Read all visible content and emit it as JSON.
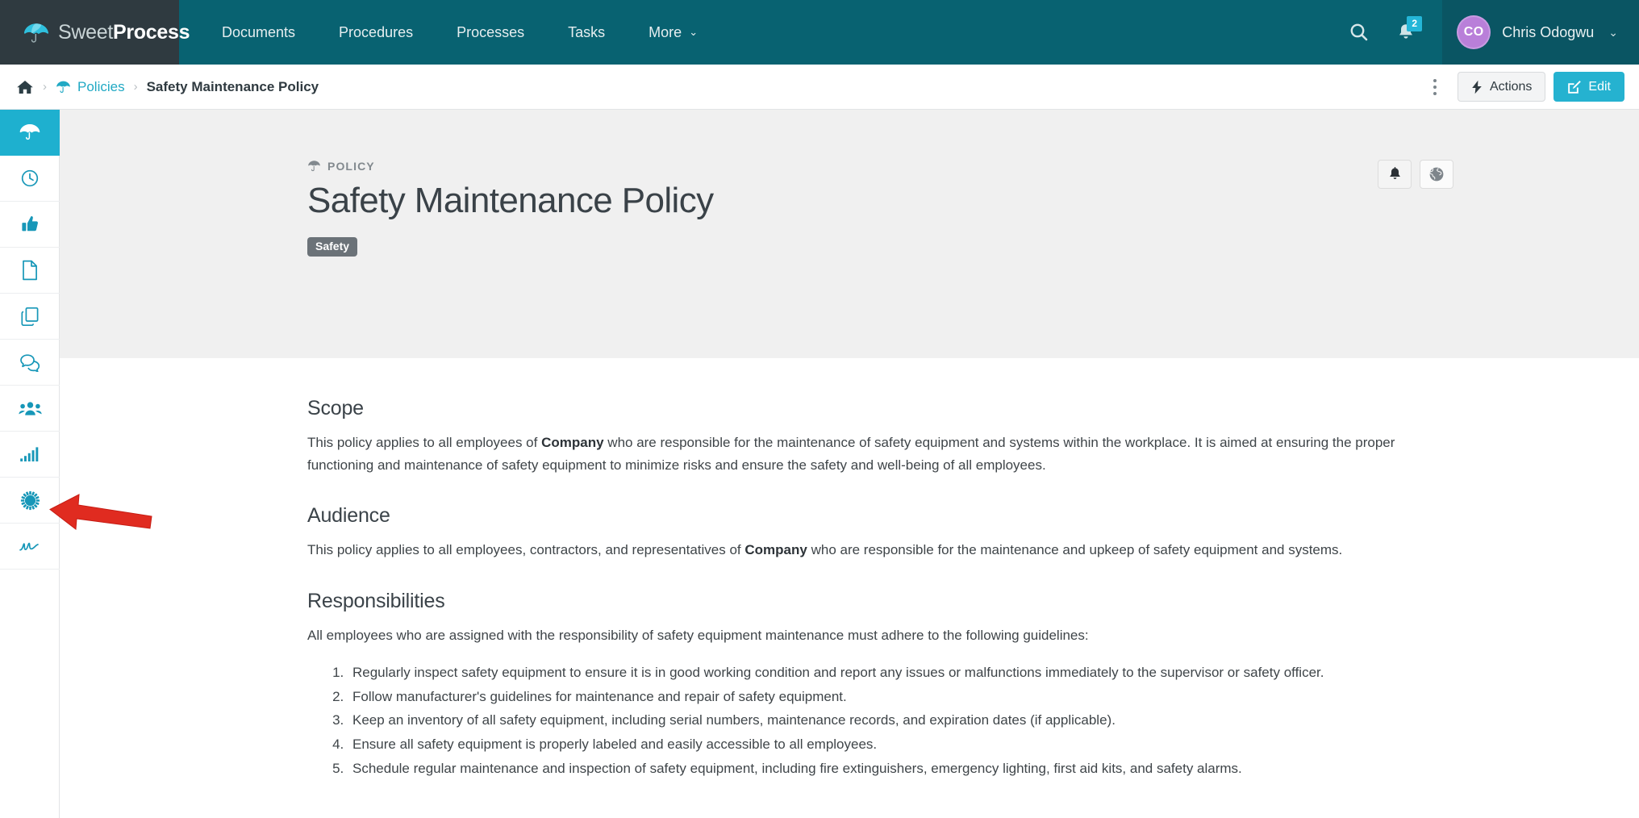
{
  "brand": {
    "name_light": "Sweet",
    "name_bold": "Process",
    "logo_icon": "umbrella-logo-icon"
  },
  "topnav": {
    "items": [
      {
        "label": "Documents",
        "name": "documents"
      },
      {
        "label": "Procedures",
        "name": "procedures"
      },
      {
        "label": "Processes",
        "name": "processes"
      },
      {
        "label": "Tasks",
        "name": "tasks"
      },
      {
        "label": "More",
        "name": "more",
        "has_caret": true
      }
    ],
    "more_caret": "⌄",
    "search_icon": "search-icon",
    "notifications_icon": "bell-icon",
    "notifications_count": "2",
    "user": {
      "initials": "CO",
      "name": "Chris Odogwu",
      "caret": "⌄"
    },
    "colors": {
      "nav_background": "#086271",
      "brand_background": "#2f3a40",
      "badge": "#24b6d8",
      "avatar": "#b97fd9"
    }
  },
  "breadcrumb": {
    "home_icon": "home-icon",
    "separator": "›",
    "policies_label": "Policies",
    "policies_icon": "umbrella-icon",
    "current_label": "Safety Maintenance Policy",
    "kebab_icon": "more-vertical-icon",
    "actions_label": "Actions",
    "actions_icon": "lightning-bolt-icon",
    "edit_label": "Edit",
    "edit_icon": "pencil-square-icon",
    "colors": {
      "link": "#21a9c4",
      "edit_button": "#25b2d0"
    }
  },
  "sidebar": {
    "items": [
      {
        "name": "policies",
        "icon": "umbrella-icon",
        "active": true
      },
      {
        "name": "recent",
        "icon": "clock-icon",
        "active": false
      },
      {
        "name": "approvals",
        "icon": "thumbs-up-icon",
        "active": false
      },
      {
        "name": "documents",
        "icon": "document-icon",
        "active": false
      },
      {
        "name": "duplicates",
        "icon": "copy-icon",
        "active": false
      },
      {
        "name": "comments",
        "icon": "chat-bubbles-icon",
        "active": false
      },
      {
        "name": "teams",
        "icon": "users-icon",
        "active": false
      },
      {
        "name": "reports",
        "icon": "bar-chart-icon",
        "active": false
      },
      {
        "name": "settings",
        "icon": "gear-sunburst-icon",
        "active": false
      },
      {
        "name": "signature",
        "icon": "signature-icon",
        "active": false
      }
    ],
    "colors": {
      "active_background": "#1eb0cf",
      "icon": "#1797b8"
    }
  },
  "document": {
    "kicker": "POLICY",
    "kicker_icon": "umbrella-icon",
    "title": "Safety Maintenance Policy",
    "tags": [
      "Safety"
    ],
    "hero_buttons": [
      {
        "name": "subscribe-button",
        "icon": "bell-icon"
      },
      {
        "name": "visibility-button",
        "icon": "globe-icon"
      }
    ],
    "sections": [
      {
        "heading": "Scope",
        "paragraph_before": "This policy applies to all employees of ",
        "paragraph_bold": "Company",
        "paragraph_after": " who are responsible for the maintenance of safety equipment and systems within the workplace. It is aimed at ensuring the proper functioning and maintenance of safety equipment to minimize risks and ensure the safety and well-being of all employees."
      },
      {
        "heading": "Audience",
        "paragraph_before": "This policy applies to all employees, contractors, and representatives of ",
        "paragraph_bold": "Company",
        "paragraph_after": " who are responsible for the maintenance and upkeep of safety equipment and systems."
      }
    ],
    "responsibilities": {
      "heading": "Responsibilities",
      "intro": "All employees who are assigned with the responsibility of safety equipment maintenance must adhere to the following guidelines:",
      "items": [
        "Regularly inspect safety equipment to ensure it is in good working condition and report any issues or malfunctions immediately to the supervisor or safety officer.",
        "Follow manufacturer's guidelines for maintenance and repair of safety equipment.",
        "Keep an inventory of all safety equipment, including serial numbers, maintenance records, and expiration dates (if applicable).",
        "Ensure all safety equipment is properly labeled and easily accessible to all employees.",
        "Schedule regular maintenance and inspection of safety equipment, including fire extinguishers, emergency lighting, first aid kits, and safety alarms."
      ]
    }
  },
  "annotation": {
    "arrow_icon": "red-arrow-pointing-left",
    "color": "#e02b20",
    "points_at": "sidebar-item-settings"
  }
}
